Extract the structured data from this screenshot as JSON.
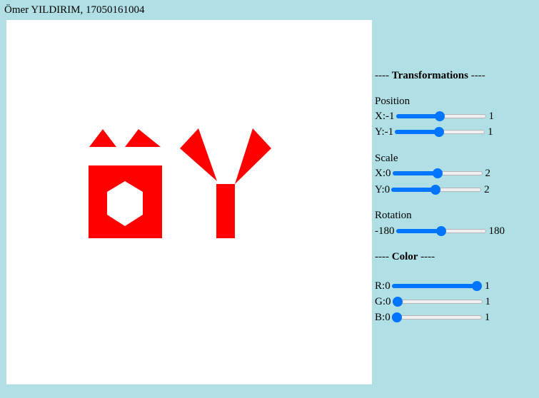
{
  "header": {
    "title": "Ömer YILDIRIM, 17050161004"
  },
  "colors": {
    "background": "#b0e0e6",
    "canvas": "#ffffff",
    "shape": "#ff0000",
    "accent": "#0075ff"
  },
  "panel": {
    "transformations_prefix": "---- ",
    "transformations_title": "Transformations",
    "transformations_suffix": " ----",
    "position": {
      "label": "Position",
      "x": {
        "axis": "X: ",
        "min": "-1",
        "max": "1",
        "value": 0.49
      },
      "y": {
        "axis": "Y: ",
        "min": "-1",
        "max": "1",
        "value": 0.49
      }
    },
    "scale": {
      "label": "Scale",
      "x": {
        "axis": "X: ",
        "min": "0",
        "max": "2",
        "value": 0.5
      },
      "y": {
        "axis": "Y: ",
        "min": "0",
        "max": "2",
        "value": 0.49
      }
    },
    "rotation": {
      "label": "Rotation",
      "min": "-180",
      "max": "180",
      "value": 0.5
    },
    "color_prefix": "---- ",
    "color_title": "Color",
    "color_suffix": " ----",
    "color": {
      "r": {
        "axis": "R: ",
        "min": "0",
        "max": "1",
        "value": 1.0
      },
      "g": {
        "axis": "G: ",
        "min": "0",
        "max": "1",
        "value": 0.0
      },
      "b": {
        "axis": "B: ",
        "min": "0",
        "max": "1",
        "value": 0.0
      }
    }
  }
}
